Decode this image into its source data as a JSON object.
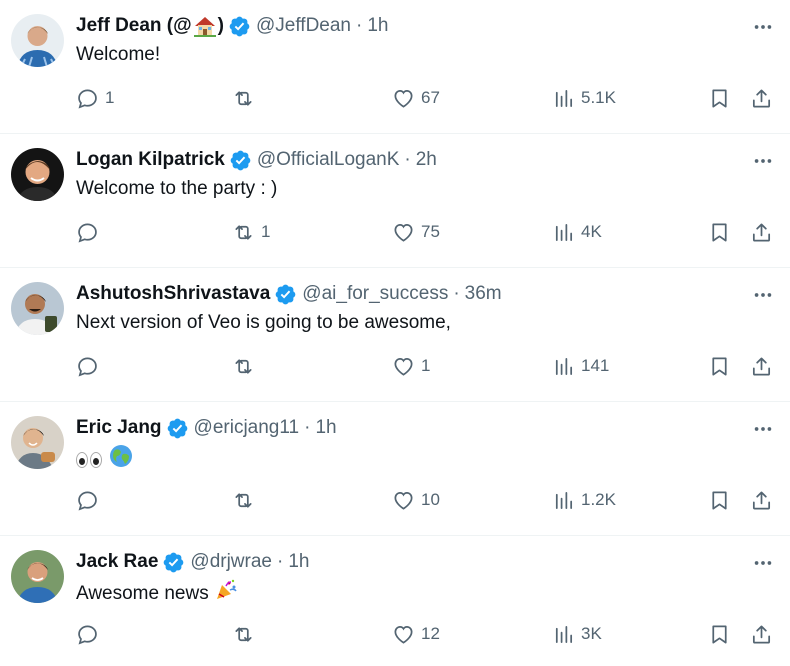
{
  "tweets": [
    {
      "name": "Jeff Dean (@",
      "name_suffix": ")",
      "handle": "@JeffDean",
      "time": "1h",
      "text": "Welcome!",
      "avatar_color": "#2b6cb0",
      "replies": "1",
      "retweets": "",
      "likes": "67",
      "views": "5.1K"
    },
    {
      "name": "Logan Kilpatrick",
      "handle": "@OfficialLoganK",
      "time": "2h",
      "text": "Welcome to the party : )",
      "avatar_color": "#1a1a1a",
      "replies": "",
      "retweets": "1",
      "likes": "75",
      "views": "4K"
    },
    {
      "name": "AshutoshShrivastava",
      "handle": "@ai_for_success",
      "time": "36m",
      "text": "Next version of Veo is going to be awesome,",
      "avatar_color": "#8fa3b3",
      "replies": "",
      "retweets": "",
      "likes": "1",
      "views": "141"
    },
    {
      "name": "Eric Jang",
      "handle": "@ericjang11",
      "time": "1h",
      "text": "",
      "avatar_color": "#c9c2b8",
      "replies": "",
      "retweets": "",
      "likes": "10",
      "views": "1.2K"
    },
    {
      "name": "Jack Rae",
      "handle": "@drjwrae",
      "time": "1h",
      "text": "Awesome news",
      "avatar_color": "#6b8f5a",
      "replies": "",
      "retweets": "",
      "likes": "12",
      "views": "3K"
    }
  ],
  "separator": "·",
  "colors": {
    "verified": "#1d9bf0",
    "secondary_text": "#536471",
    "primary_text": "#0f1419",
    "divider": "#eff3f4"
  },
  "icons": {
    "reply": "reply-icon",
    "retweet": "retweet-icon",
    "like": "heart-icon",
    "views": "views-icon",
    "bookmark": "bookmark-icon",
    "share": "share-icon",
    "more": "more-icon",
    "verified": "verified-badge-icon"
  }
}
